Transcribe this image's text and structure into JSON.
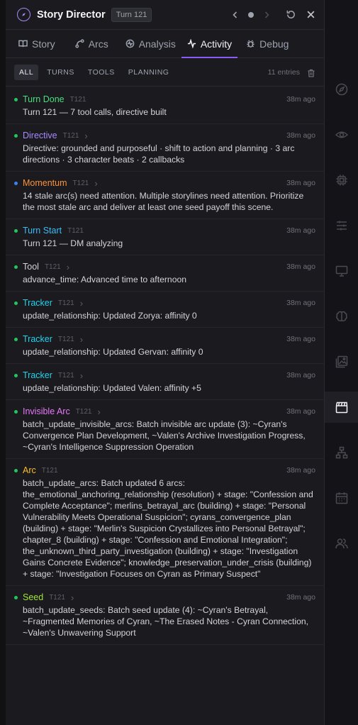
{
  "header": {
    "title": "Story Director",
    "turn_badge": "Turn 121",
    "prev_icon": "chevron-left-icon",
    "next_icon": "chevron-right-icon",
    "refresh_icon": "refresh-icon",
    "close_icon": "close-icon"
  },
  "tabs": [
    {
      "label": "Story",
      "icon": "book-icon"
    },
    {
      "label": "Arcs",
      "icon": "arcs-icon"
    },
    {
      "label": "Analysis",
      "icon": "analysis-icon"
    },
    {
      "label": "Activity",
      "icon": "activity-icon",
      "active": true
    },
    {
      "label": "Debug",
      "icon": "bug-icon"
    }
  ],
  "filters": {
    "options": [
      "ALL",
      "TURNS",
      "TOOLS",
      "PLANNING"
    ],
    "selected": "ALL",
    "count_label": "11 entries"
  },
  "colors": {
    "turn_done": "#22c55e",
    "directive": "#a78bfa",
    "momentum": "#f97316",
    "turn_start": "#38bdf8",
    "tool": "#d4d4d8",
    "tracker": "#22d3ee",
    "invisible_arc": "#e879f9",
    "arc": "#fbbf24",
    "seed": "#a3e635",
    "accent": "#8b5cf6"
  },
  "entries": [
    {
      "type": "Turn Done",
      "turn": "T121",
      "time": "38m ago",
      "text": "Turn 121 — 7 tool calls, directive built",
      "color": "#4ade80",
      "dot": "#22c55e",
      "chevron": false
    },
    {
      "type": "Directive",
      "turn": "T121",
      "time": "38m ago",
      "text": "Directive: grounded and purposeful · shift to action and planning · 3 arc directions · 3 character beats · 2 callbacks",
      "color": "#a78bfa",
      "dot": "#22c55e",
      "chevron": true
    },
    {
      "type": "Momentum",
      "turn": "T121",
      "time": "38m ago",
      "text": "14 stale arc(s) need attention. Multiple storylines need attention. Prioritize the most stale arc and deliver at least one seed payoff this scene.",
      "color": "#fb923c",
      "dot": "#3b82f6",
      "chevron": true
    },
    {
      "type": "Turn Start",
      "turn": "T121",
      "time": "38m ago",
      "text": "Turn 121 — DM analyzing",
      "color": "#38bdf8",
      "dot": "#22c55e",
      "chevron": false
    },
    {
      "type": "Tool",
      "turn": "T121",
      "time": "38m ago",
      "text": "advance_time: Advanced time to afternoon",
      "color": "#d4d4d8",
      "dot": "#22c55e",
      "chevron": true
    },
    {
      "type": "Tracker",
      "turn": "T121",
      "time": "38m ago",
      "text": "update_relationship: Updated Zorya: affinity 0",
      "color": "#22d3ee",
      "dot": "#22c55e",
      "chevron": true
    },
    {
      "type": "Tracker",
      "turn": "T121",
      "time": "38m ago",
      "text": "update_relationship: Updated Gervan: affinity 0",
      "color": "#22d3ee",
      "dot": "#22c55e",
      "chevron": true
    },
    {
      "type": "Tracker",
      "turn": "T121",
      "time": "38m ago",
      "text": "update_relationship: Updated Valen: affinity +5",
      "color": "#22d3ee",
      "dot": "#22c55e",
      "chevron": true
    },
    {
      "type": "Invisible Arc",
      "turn": "T121",
      "time": "38m ago",
      "text": "batch_update_invisible_arcs: Batch invisible arc update (3): ~Cyran's Convergence Plan Development, ~Valen's Archive Investigation Progress, ~Cyran's Intelligence Suppression Operation",
      "color": "#e879f9",
      "dot": "#22c55e",
      "chevron": true
    },
    {
      "type": "Arc",
      "turn": "T121",
      "time": "38m ago",
      "text": "batch_update_arcs: Batch updated 6 arcs: the_emotional_anchoring_relationship (resolution) + stage: \"Confession and Complete Acceptance\"; merlins_betrayal_arc (building) + stage: \"Personal Vulnerability Meets Operational Suspicion\"; cyrans_convergence_plan (building) + stage: \"Merlin's Suspicion Crystallizes into Personal Betrayal\"; chapter_8 (building) + stage: \"Confession and Emotional Integration\"; the_unknown_third_party_investigation (building) + stage: \"Investigation Gains Concrete Evidence\"; knowledge_preservation_under_crisis (building) + stage: \"Investigation Focuses on Cyran as Primary Suspect\"",
      "color": "#fbbf24",
      "dot": "#22c55e",
      "chevron": false
    },
    {
      "type": "Seed",
      "turn": "T121",
      "time": "38m ago",
      "text": "batch_update_seeds: Batch seed update (4): ~Cyran's Betrayal, ~Fragmented Memories of Cyran, ~The Erased Notes - Cyran Connection, ~Valen's Unwavering Support",
      "color": "#a3e635",
      "dot": "#22c55e",
      "chevron": true
    }
  ],
  "rail": {
    "icons": [
      "compass-icon",
      "eye-icon",
      "chip-icon",
      "sliders-icon",
      "monitor-icon",
      "brain-icon",
      "images-icon",
      "clapperboard-icon",
      "network-icon",
      "calendar-icon",
      "users-icon"
    ],
    "active": "clapperboard-icon"
  }
}
